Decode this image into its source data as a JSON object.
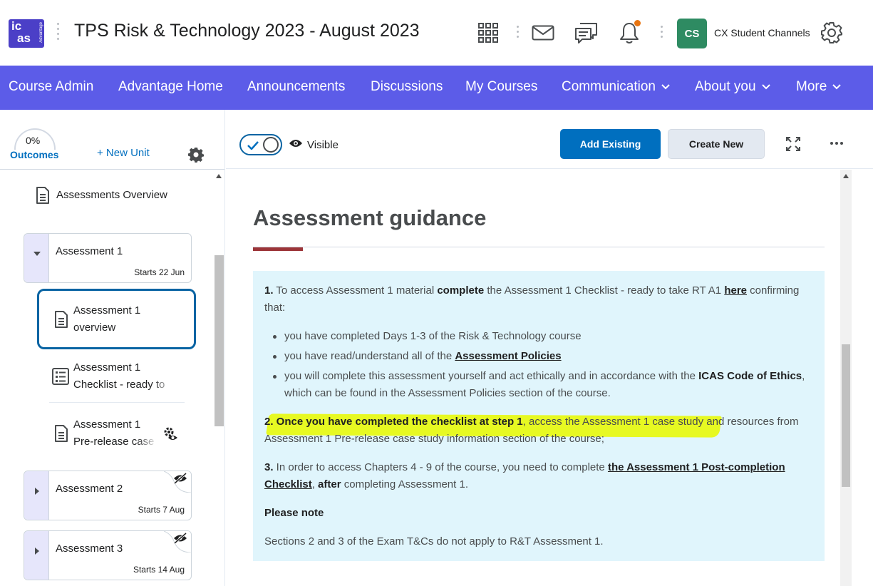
{
  "header": {
    "logo_line1": "ic",
    "logo_line2": "as",
    "logo_sub": "Advantage",
    "course_title": "TPS Risk & Technology 2023 - August 2023",
    "icons": [
      "apps-grid-icon",
      "mail-icon",
      "chat-icon",
      "bell-icon",
      "settings-gear-icon"
    ],
    "avatar_initials": "CS",
    "user_name": "CX Student Channels",
    "notification_color": "#e87511"
  },
  "nav": {
    "items": [
      {
        "label": "Course Admin"
      },
      {
        "label": "Advantage Home"
      },
      {
        "label": "Announcements"
      },
      {
        "label": "Discussions"
      },
      {
        "label": "My Courses"
      },
      {
        "label": "Communication"
      },
      {
        "label": "About you"
      },
      {
        "label": "More"
      }
    ],
    "background": "#5c5ce8"
  },
  "sidebar": {
    "outcomes_percent": "0%",
    "outcomes_label": "Outcomes",
    "new_unit_label": "+ New Unit",
    "assessments_overview": "Assessments Overview",
    "units": [
      {
        "title": "Assessment 1",
        "starts": "Starts 22 Jun",
        "expanded": true,
        "hidden": false
      },
      {
        "title": "Assessment 2",
        "starts": "Starts 7 Aug",
        "expanded": false,
        "hidden": true
      },
      {
        "title": "Assessment 3",
        "starts": "Starts 14 Aug",
        "expanded": false,
        "hidden": true
      }
    ],
    "topics": [
      {
        "line1": "Assessment 1",
        "line2": "overview",
        "selected": true
      },
      {
        "line1": "Assessment 1",
        "line2": "Checklist - ready to",
        "selected": false
      },
      {
        "line1": "Assessment 1",
        "line2": "Pre-release case",
        "selected": false
      }
    ]
  },
  "toolbar": {
    "visible_label": "Visible",
    "add_existing": "Add Existing",
    "create_new": "Create New"
  },
  "content": {
    "heading": "Assessment guidance",
    "p1_num": "1.",
    "p1_a": " To access Assessment 1 material ",
    "p1_b": "complete",
    "p1_c": " the Assessment 1 Checklist - ready to take RT A1 ",
    "p1_link": "here",
    "p1_d": " confirming that:",
    "bullet1": "you have completed Days 1-3 of the Risk & Technology course",
    "bullet2_a": "you have read/understand  all of the ",
    "bullet2_link": "Assessment Policies",
    "bullet3_a": "you will complete this assessment yourself and act ethically and in accordance with the ",
    "bullet3_b": "ICAS Code of Ethics",
    "bullet3_c": ", which can be found in the Assessment Policies section of the course.",
    "p2_bold": "2. Once you have completed the checklist at step 1",
    "p2_rest": ", access the Assessment 1 case study and resources from Assessment 1 Pre-release case study information section of the course;",
    "p3_num": "3.",
    "p3_a": " In order to access Chapters 4 - 9 of the course, you need to complete ",
    "p3_link": "the Assessment 1 Post-completion Checklist",
    "p3_b": ", ",
    "p3_bold": "after",
    "p3_c": " completing Assessment 1.",
    "note_heading": "Please note",
    "note_text": "Sections 2 and 3 of the Exam T&Cs do not apply to R&T Assessment 1."
  }
}
